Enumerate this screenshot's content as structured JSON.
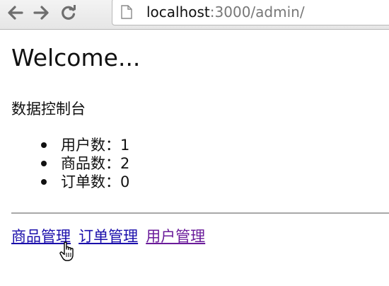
{
  "browser": {
    "url_host": "localhost",
    "url_rest": ":3000/admin/",
    "icons": {
      "back": "back-arrow-icon",
      "forward": "forward-arrow-icon",
      "reload": "reload-icon",
      "page": "page-icon"
    }
  },
  "page": {
    "title": "Welcome...",
    "section_title": "数据控制台",
    "stats": [
      {
        "label": "用户数",
        "value": "1"
      },
      {
        "label": "商品数",
        "value": "2"
      },
      {
        "label": "订单数",
        "value": "0"
      }
    ],
    "stats_separator": "：",
    "links": [
      {
        "label": "商品管理",
        "state": "hover"
      },
      {
        "label": "订单管理",
        "state": "default"
      },
      {
        "label": "用户管理",
        "state": "visited"
      }
    ]
  },
  "colors": {
    "link": "#1a0dab",
    "visited_link": "#6a1b9a",
    "text": "#111111"
  }
}
